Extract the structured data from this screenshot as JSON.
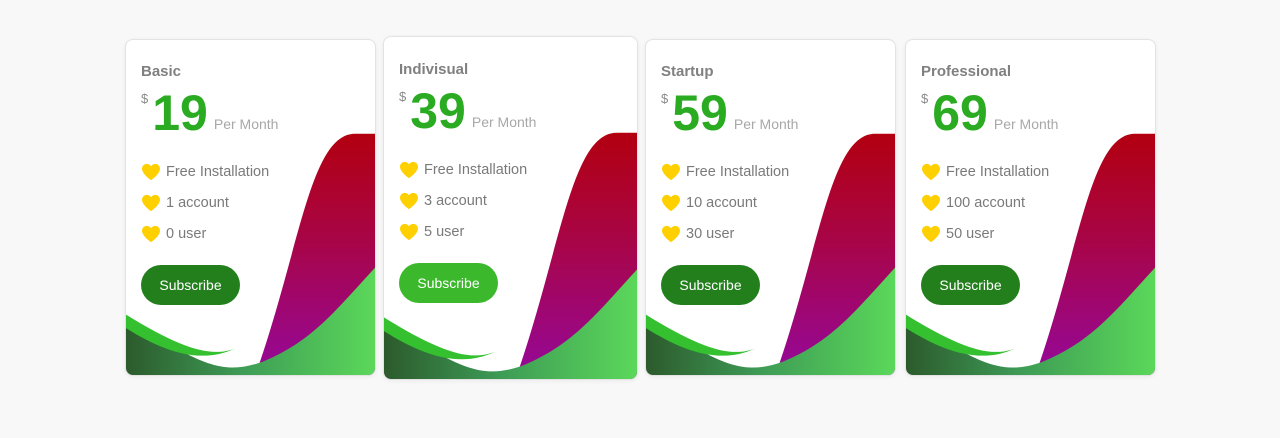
{
  "plans": [
    {
      "name": "Basic",
      "currency": "$",
      "price": "19",
      "period": "Per Month",
      "features": [
        "Free Installation",
        "1 account",
        "0 user"
      ],
      "button": "Subscribe"
    },
    {
      "name": "Indivisual",
      "currency": "$",
      "price": "39",
      "period": "Per Month",
      "features": [
        "Free Installation",
        "3 account",
        "5 user"
      ],
      "button": "Subscribe"
    },
    {
      "name": "Startup",
      "currency": "$",
      "price": "59",
      "period": "Per Month",
      "features": [
        "Free Installation",
        "10 account",
        "30 user"
      ],
      "button": "Subscribe"
    },
    {
      "name": "Professional",
      "currency": "$",
      "price": "69",
      "period": "Per Month",
      "features": [
        "Free Installation",
        "100 account",
        "50 user"
      ],
      "button": "Subscribe"
    }
  ],
  "icons": {
    "feature": "heart-icon"
  },
  "colors": {
    "price": "#2aab22",
    "button": "#227f1c",
    "button_highlight": "#3bb82c",
    "heart": "#ffd000",
    "wave_red": "#b00010",
    "wave_purple": "#9a0a8a",
    "wave_green": "#3cc23a"
  }
}
